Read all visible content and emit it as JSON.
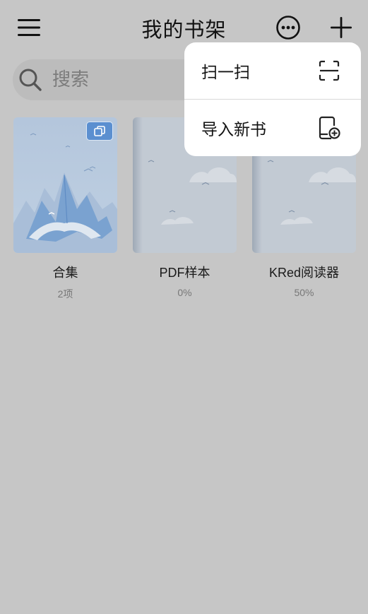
{
  "header": {
    "title": "我的书架",
    "menu_icon": "hamburger-menu-icon",
    "more_icon": "more-circle-icon",
    "add_icon": "plus-icon"
  },
  "search": {
    "placeholder": "搜索",
    "icon": "search-icon"
  },
  "books": [
    {
      "title": "合集",
      "subtitle": "2项",
      "is_collection": true
    },
    {
      "title": "PDF样本",
      "subtitle": "0%"
    },
    {
      "title": "KRed阅读器",
      "subtitle": "50%"
    }
  ],
  "popup_menu": {
    "items": [
      {
        "label": "扫一扫",
        "icon": "scan-icon"
      },
      {
        "label": "导入新书",
        "icon": "import-book-icon"
      }
    ]
  },
  "colors": {
    "background_dim": "#c6c6c6",
    "popup_bg": "#ffffff",
    "badge_blue": "#5b8fd0",
    "cover_sky": "#b9c9dc"
  }
}
